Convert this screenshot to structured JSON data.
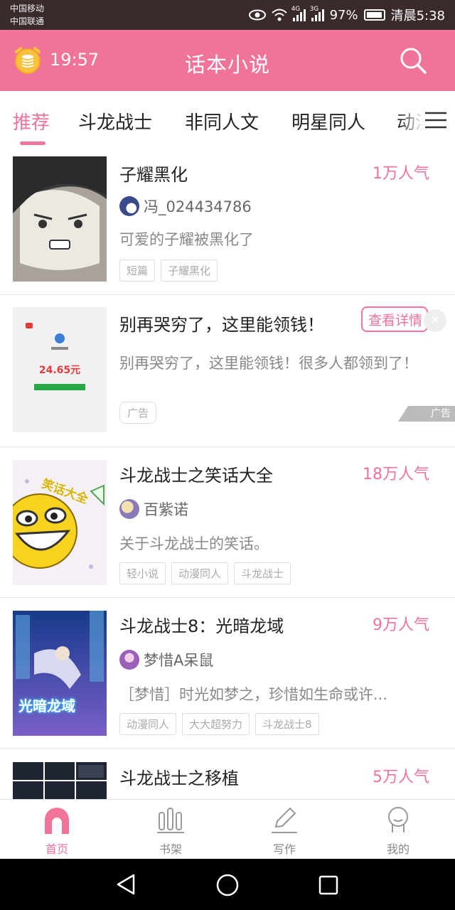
{
  "status_bar": {
    "carrier1": "中国移动",
    "carrier2": "中国联通",
    "net1": "4G",
    "net2": "3G",
    "battery": "97%",
    "time": "清晨5:38"
  },
  "header": {
    "alarm_time": "19:57",
    "title": "话本小说",
    "accent_color": "#f07399"
  },
  "tabs": [
    {
      "label": "推荐",
      "active": true
    },
    {
      "label": "斗龙战士"
    },
    {
      "label": "非同人文"
    },
    {
      "label": "明星同人"
    },
    {
      "label": "动漫"
    }
  ],
  "items": [
    {
      "title": "子耀黑化",
      "popularity": "1万人气",
      "author": "冯_024434786",
      "description": "可爱的子耀被黑化了",
      "tags": [
        "短篇",
        "子耀黑化"
      ]
    },
    {
      "title": "斗龙战士之笑话大全",
      "popularity": "18万人气",
      "author": "百紫诺",
      "description": "关于斗龙战士的笑话。",
      "tags": [
        "轻小说",
        "动漫同人",
        "斗龙战士"
      ],
      "cover_text": "笑话大全"
    },
    {
      "title": "斗龙战士8：光暗龙域",
      "popularity": "9万人气",
      "author": "梦惜A呆鼠",
      "description": "［梦惜］时光如梦之，珍惜如生命或许...",
      "tags": [
        "动漫同人",
        "大大超努力",
        "斗龙战士8"
      ],
      "cover_text": "光暗龙域"
    },
    {
      "title": "斗龙战士之移植",
      "popularity": "5万人气"
    }
  ],
  "ad": {
    "title": "别再哭穷了，这里能领钱！",
    "detail_button": "查看详情",
    "description": "别再哭穷了，这里能领钱！很多人都领到了！",
    "tag": "广告",
    "badge": "广告",
    "amount": "24.65元"
  },
  "bottom_nav": [
    {
      "label": "首页",
      "icon": "home-icon",
      "active": true
    },
    {
      "label": "书架",
      "icon": "bookshelf-icon"
    },
    {
      "label": "写作",
      "icon": "pen-icon"
    },
    {
      "label": "我的",
      "icon": "profile-icon"
    }
  ]
}
